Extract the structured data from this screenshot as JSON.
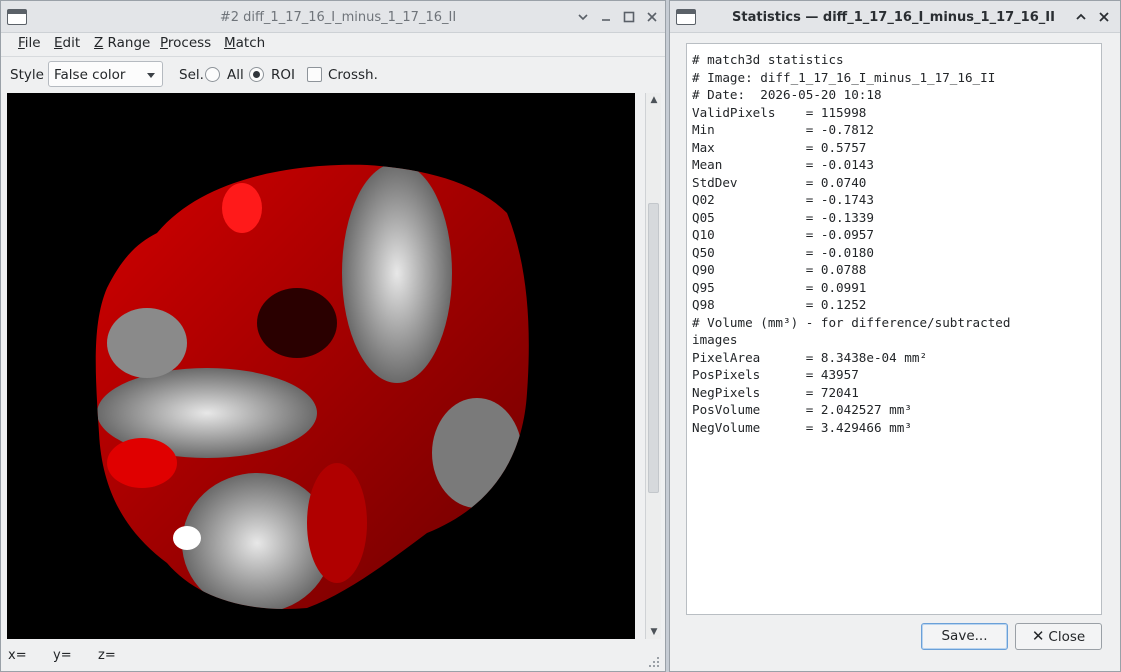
{
  "left_window": {
    "title": "#2 diff_1_17_16_I_minus_1_17_16_II",
    "menu": [
      {
        "label": "File",
        "mnemonic": "F",
        "rest": "ile"
      },
      {
        "label": "Edit",
        "mnemonic": "E",
        "rest": "dit"
      },
      {
        "label": "Z Range",
        "mnemonic": "Z",
        "rest": " Range"
      },
      {
        "label": "Process",
        "mnemonic": "P",
        "rest": "rocess"
      },
      {
        "label": "Match",
        "mnemonic": "M",
        "rest": "atch"
      }
    ],
    "toolbar": {
      "style_label": "Style",
      "style_value": "False color",
      "sel_label": "Sel.",
      "all_label": "All",
      "roi_label": "ROI",
      "selected": "ROI",
      "crosshair_label": "Crossh.",
      "crosshair_checked": false
    },
    "status": {
      "x_label": "x=",
      "y_label": "y=",
      "z_label": "z="
    },
    "image": {
      "description_icon": "false-color-difference-image",
      "colormap": [
        "#000000",
        "#ffffff",
        "#ff0000"
      ]
    }
  },
  "right_window": {
    "title": "Statistics — diff_1_17_16_I_minus_1_17_16_II",
    "stats_lines": [
      "# match3d statistics",
      "# Image: diff_1_17_16_I_minus_1_17_16_II",
      "# Date:  2026-05-20 10:18",
      "ValidPixels    = 115998",
      "Min            = -0.7812",
      "Max            = 0.5757",
      "Mean           = -0.0143",
      "StdDev         = 0.0740",
      "Q02            = -0.1743",
      "Q05            = -0.1339",
      "Q10            = -0.0957",
      "Q50            = -0.0180",
      "Q90            = 0.0788",
      "Q95            = 0.0991",
      "Q98            = 0.1252",
      "# Volume (mm³) - for difference/subtracted",
      "images",
      "PixelArea      = 8.3438e-04 mm²",
      "PosPixels      = 43957",
      "NegPixels      = 72041",
      "PosVolume      = 2.042527 mm³",
      "NegVolume      = 3.429466 mm³"
    ],
    "save_label": "Save...",
    "close_label": "Close"
  }
}
